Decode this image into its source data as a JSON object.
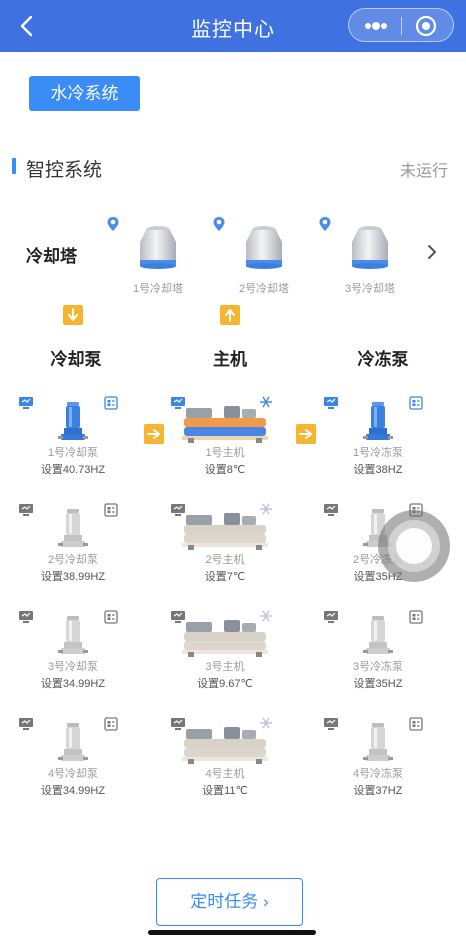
{
  "header": {
    "title": "监控中心"
  },
  "system_button": "水冷系统",
  "section": {
    "title": "智控系统",
    "status": "未运行"
  },
  "cooling_towers": {
    "label": "冷却塔",
    "items": [
      {
        "name": "1号冷却塔"
      },
      {
        "name": "2号冷却塔"
      },
      {
        "name": "3号冷却塔"
      }
    ]
  },
  "columns": {
    "cooling_pump": "冷却泵",
    "host": "主机",
    "chilled_pump": "冷冻泵"
  },
  "rows": [
    {
      "cooling_pump": {
        "name": "1号冷却泵",
        "setting": "设置40.73HZ",
        "active": true
      },
      "host": {
        "name": "1号主机",
        "setting": "设置8℃",
        "active": true
      },
      "chilled_pump": {
        "name": "1号冷冻泵",
        "setting": "设置38HZ",
        "active": true
      }
    },
    {
      "cooling_pump": {
        "name": "2号冷却泵",
        "setting": "设置38.99HZ",
        "active": false
      },
      "host": {
        "name": "2号主机",
        "setting": "设置7℃",
        "active": false
      },
      "chilled_pump": {
        "name": "2号冷冻泵",
        "setting": "设置35HZ",
        "active": false
      }
    },
    {
      "cooling_pump": {
        "name": "3号冷却泵",
        "setting": "设置34.99HZ",
        "active": false
      },
      "host": {
        "name": "3号主机",
        "setting": "设置9.67℃",
        "active": false
      },
      "chilled_pump": {
        "name": "3号冷冻泵",
        "setting": "设置35HZ",
        "active": false
      }
    },
    {
      "cooling_pump": {
        "name": "4号冷却泵",
        "setting": "设置34.99HZ",
        "active": false
      },
      "host": {
        "name": "4号主机",
        "setting": "设置11℃",
        "active": false
      },
      "chilled_pump": {
        "name": "4号冷冻泵",
        "setting": "设置37HZ",
        "active": false
      }
    }
  ],
  "bottom_button": "定时任务",
  "colors": {
    "header": "#3f72e0",
    "accent": "#3a8cf6",
    "arrow": "#f6b531",
    "active_unit": "#3b86e6",
    "inactive_unit": "#c8c8c8"
  },
  "icons": [
    "back-icon",
    "more-icon",
    "target-icon",
    "location-pin-icon",
    "chevron-right-icon",
    "arrow-down-icon",
    "arrow-up-icon",
    "arrow-right-icon",
    "monitor-icon",
    "config-icon",
    "snowflake-icon"
  ]
}
